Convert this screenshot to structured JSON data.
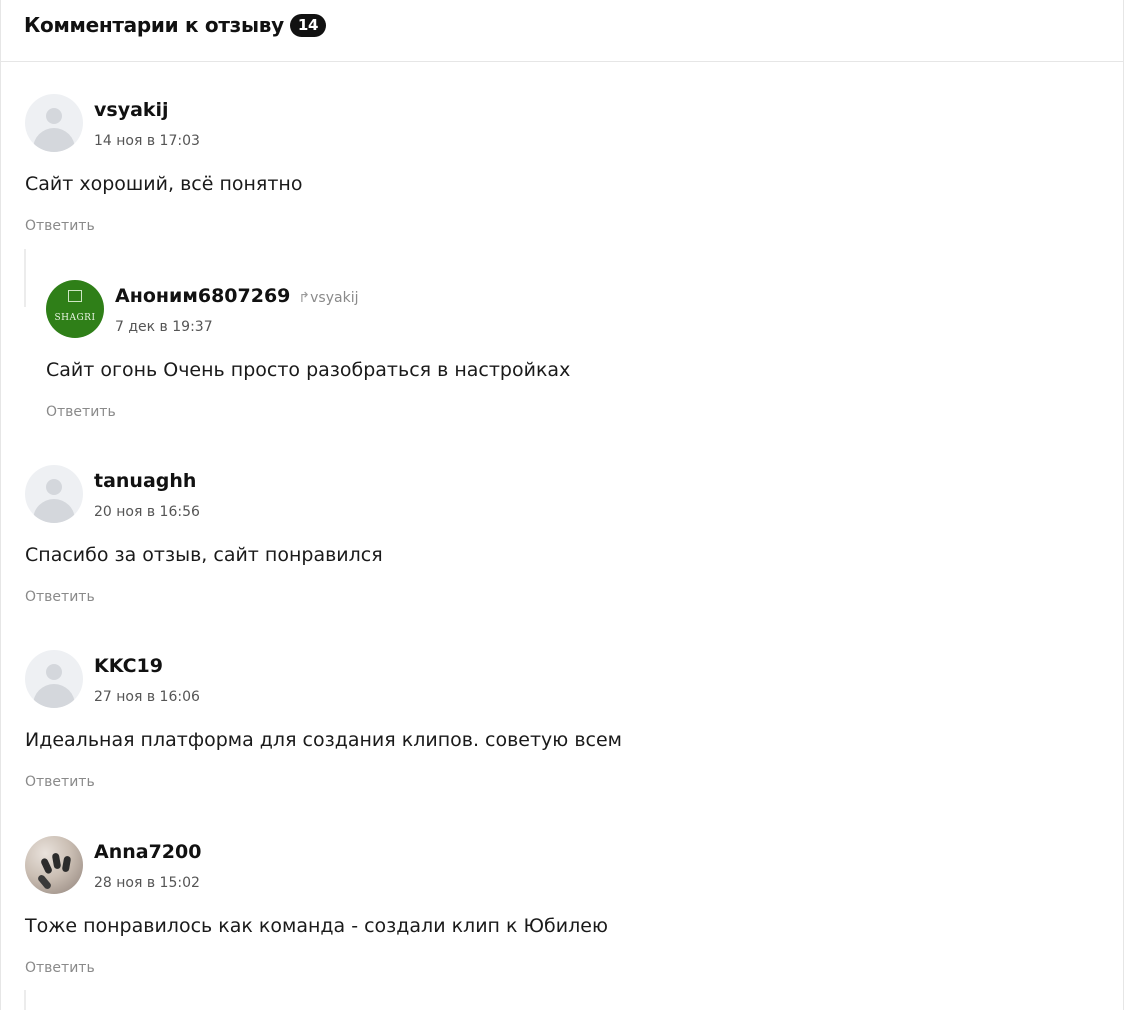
{
  "header": {
    "title": "Комментарии к отзыву",
    "count": "14"
  },
  "comments": [
    {
      "author": "vsyakij",
      "date": "14 ноя в 17:03",
      "text": "Сайт хороший, всё понятно",
      "reply_label": "Ответить",
      "avatar": "default-user-icon"
    },
    {
      "author": "Аноним6807269",
      "reply_to": "vsyakij",
      "date": "7 дек в 19:37",
      "text": "Сайт огонь Очень просто разобраться в настройках",
      "reply_label": "Ответить",
      "avatar": "shagri-logo",
      "avatar_text": "SHAGRI",
      "avatar_color": "#2f7f18"
    },
    {
      "author": "tanuaghh",
      "date": "20 ноя в 16:56",
      "text": "Спасибо за отзыв, сайт понравился",
      "reply_label": "Ответить",
      "avatar": "default-user-icon"
    },
    {
      "author": "KKC19",
      "date": "27 ноя в 16:06",
      "text": "Идеальная платформа для создания клипов. советую всем",
      "reply_label": "Ответить",
      "avatar": "default-user-icon"
    },
    {
      "author": "Anna7200",
      "date": "28 ноя в 15:02",
      "text": "Тоже понравилось как команда - создали клип к Юбилею",
      "reply_label": "Ответить",
      "avatar": "photo-avatar"
    }
  ]
}
